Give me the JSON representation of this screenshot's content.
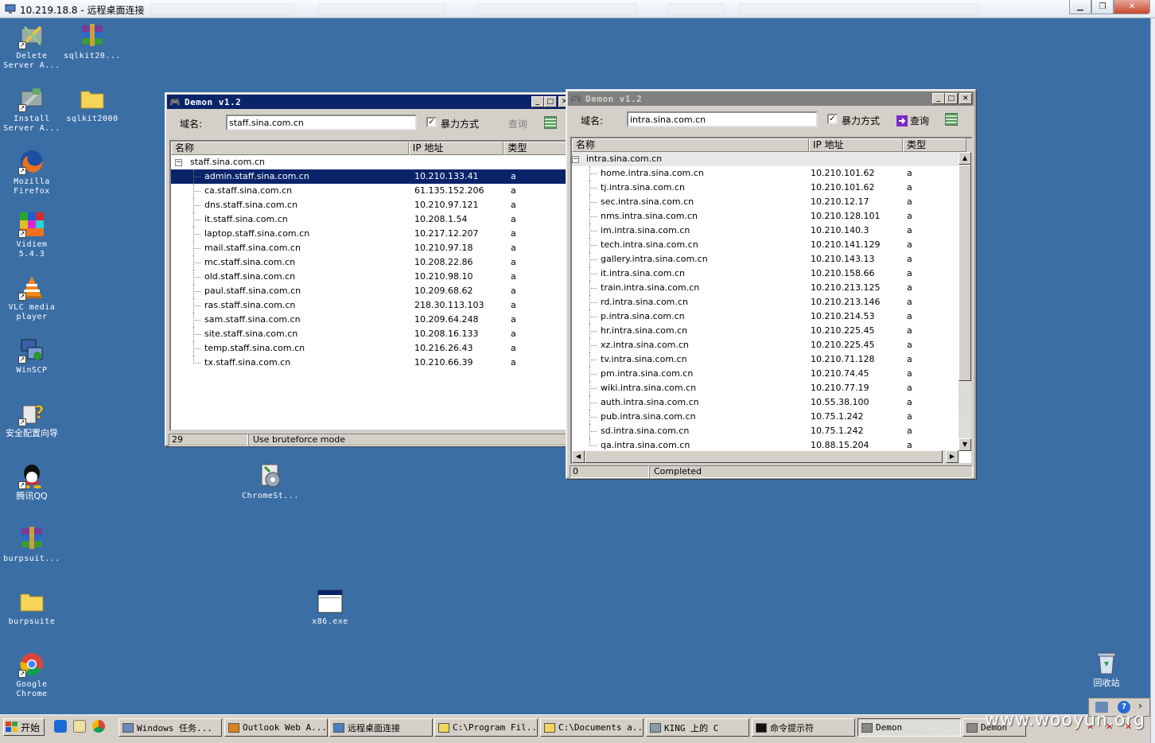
{
  "rdp": {
    "title": "10.219.18.8 - 远程桌面连接"
  },
  "desktop_icons": [
    {
      "label": "Delete Server A...",
      "icon": "tools-icon"
    },
    {
      "label": "sqlkit20...",
      "icon": "winrar-icon"
    },
    {
      "label": "Install Server A...",
      "icon": "install-icon"
    },
    {
      "label": "sqlkit2000",
      "icon": "folder-icon"
    },
    {
      "label": "Mozilla Firefox",
      "icon": "firefox-icon"
    },
    {
      "label": "Vidiem 5.4.3",
      "icon": "vidiem-icon"
    },
    {
      "label": "VLC media player",
      "icon": "vlc-icon"
    },
    {
      "label": "WinSCP",
      "icon": "winscp-icon"
    },
    {
      "label": "安全配置向导",
      "icon": "security-wizard-icon"
    },
    {
      "label": "腾讯QQ",
      "icon": "qq-icon"
    },
    {
      "label": "ChromeSt...",
      "icon": "installer-icon"
    },
    {
      "label": "burpsuit...",
      "icon": "winrar-icon"
    },
    {
      "label": "burpsuite",
      "icon": "folder-icon"
    },
    {
      "label": "x86.exe",
      "icon": "exe-icon"
    },
    {
      "label": "Google Chrome",
      "icon": "chrome-icon"
    },
    {
      "label": "回收站",
      "icon": "recycle-bin-icon"
    }
  ],
  "win1": {
    "title": "Demon v1.2",
    "domain_label": "域名:",
    "domain_value": "staff.sina.com.cn",
    "brute_label": "暴力方式",
    "brute_checked": "✓",
    "query_label": "查询",
    "headers": [
      "名称",
      "IP 地址",
      "类型"
    ],
    "root": "staff.sina.com.cn",
    "rows": [
      [
        "admin.staff.sina.com.cn",
        "10.210.133.41",
        "a"
      ],
      [
        "ca.staff.sina.com.cn",
        "61.135.152.206",
        "a"
      ],
      [
        "dns.staff.sina.com.cn",
        "10.210.97.121",
        "a"
      ],
      [
        "it.staff.sina.com.cn",
        "10.208.1.54",
        "a"
      ],
      [
        "laptop.staff.sina.com.cn",
        "10.217.12.207",
        "a"
      ],
      [
        "mail.staff.sina.com.cn",
        "10.210.97.18",
        "a"
      ],
      [
        "mc.staff.sina.com.cn",
        "10.208.22.86",
        "a"
      ],
      [
        "old.staff.sina.com.cn",
        "10.210.98.10",
        "a"
      ],
      [
        "paul.staff.sina.com.cn",
        "10.209.68.62",
        "a"
      ],
      [
        "ras.staff.sina.com.cn",
        "218.30.113.103",
        "a"
      ],
      [
        "sam.staff.sina.com.cn",
        "10.209.64.248",
        "a"
      ],
      [
        "site.staff.sina.com.cn",
        "10.208.16.133",
        "a"
      ],
      [
        "temp.staff.sina.com.cn",
        "10.216.26.43",
        "a"
      ],
      [
        "tx.staff.sina.com.cn",
        "10.210.66.39",
        "a"
      ]
    ],
    "status_count": "29",
    "status_text": "Use bruteforce mode"
  },
  "win2": {
    "title": "Demon v1.2",
    "domain_label": "域名:",
    "domain_value": "intra.sina.com.cn",
    "brute_label": "暴力方式",
    "brute_checked": "✓",
    "query_label": "查询",
    "headers": [
      "名称",
      "IP 地址",
      "类型"
    ],
    "root": "intra.sina.com.cn",
    "rows": [
      [
        "home.intra.sina.com.cn",
        "10.210.101.62",
        "a"
      ],
      [
        "tj.intra.sina.com.cn",
        "10.210.101.62",
        "a"
      ],
      [
        "sec.intra.sina.com.cn",
        "10.210.12.17",
        "a"
      ],
      [
        "nms.intra.sina.com.cn",
        "10.210.128.101",
        "a"
      ],
      [
        "im.intra.sina.com.cn",
        "10.210.140.3",
        "a"
      ],
      [
        "tech.intra.sina.com.cn",
        "10.210.141.129",
        "a"
      ],
      [
        "gallery.intra.sina.com.cn",
        "10.210.143.13",
        "a"
      ],
      [
        "it.intra.sina.com.cn",
        "10.210.158.66",
        "a"
      ],
      [
        "train.intra.sina.com.cn",
        "10.210.213.125",
        "a"
      ],
      [
        "rd.intra.sina.com.cn",
        "10.210.213.146",
        "a"
      ],
      [
        "p.intra.sina.com.cn",
        "10.210.214.53",
        "a"
      ],
      [
        "hr.intra.sina.com.cn",
        "10.210.225.45",
        "a"
      ],
      [
        "xz.intra.sina.com.cn",
        "10.210.225.45",
        "a"
      ],
      [
        "tv.intra.sina.com.cn",
        "10.210.71.128",
        "a"
      ],
      [
        "pm.intra.sina.com.cn",
        "10.210.74.45",
        "a"
      ],
      [
        "wiki.intra.sina.com.cn",
        "10.210.77.19",
        "a"
      ],
      [
        "auth.intra.sina.com.cn",
        "10.55.38.100",
        "a"
      ],
      [
        "pub.intra.sina.com.cn",
        "10.75.1.242",
        "a"
      ],
      [
        "sd.intra.sina.com.cn",
        "10.75.1.242",
        "a"
      ],
      [
        "qa.intra.sina.com.cn",
        "10.88.15.204",
        "a"
      ]
    ],
    "status_count": "0",
    "status_text": "Completed"
  },
  "taskbar": {
    "start_label": "开始",
    "tasks": [
      {
        "label": "Windows 任务...",
        "icon": "task-manager-icon"
      },
      {
        "label": "Outlook Web A...",
        "icon": "outlook-icon"
      },
      {
        "label": "远程桌面连接",
        "icon": "rdp-icon"
      },
      {
        "label": "C:\\Program Fil...",
        "icon": "folder-icon"
      },
      {
        "label": "C:\\Documents a...",
        "icon": "folder-icon"
      },
      {
        "label": "KING 上的 C",
        "icon": "network-drive-icon"
      },
      {
        "label": "命令提示符",
        "icon": "cmd-icon"
      },
      {
        "label": "Demon",
        "icon": "demon-icon"
      },
      {
        "label": "Demon",
        "icon": "demon-icon"
      }
    ]
  },
  "watermark": "www.wooyun.org"
}
